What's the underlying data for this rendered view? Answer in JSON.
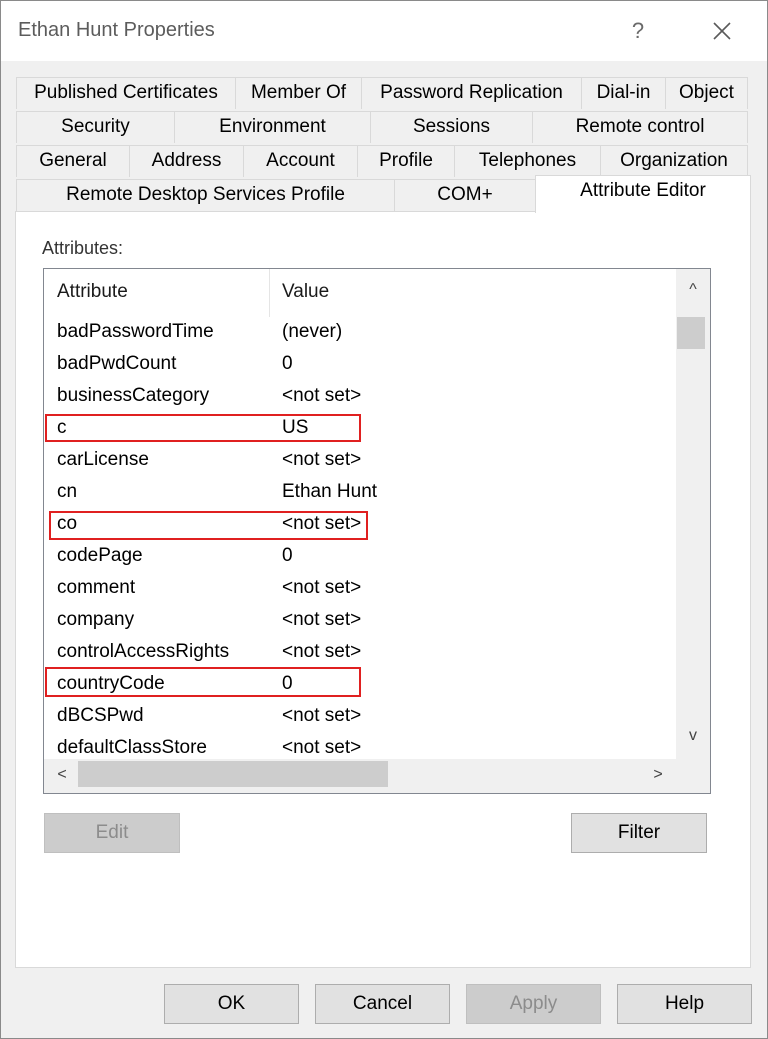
{
  "window": {
    "title": "Ethan Hunt Properties",
    "help_glyph": "?",
    "close_icon": "close-icon"
  },
  "tabs": {
    "row1": [
      "Published Certificates",
      "Member Of",
      "Password Replication",
      "Dial-in",
      "Object"
    ],
    "row2": [
      "Security",
      "Environment",
      "Sessions",
      "Remote control"
    ],
    "row3": [
      "General",
      "Address",
      "Account",
      "Profile",
      "Telephones",
      "Organization"
    ],
    "row4": [
      "Remote Desktop Services Profile",
      "COM+",
      "Attribute Editor"
    ],
    "active": "Attribute Editor"
  },
  "attributes": {
    "label": "Attributes:",
    "columns": [
      "Attribute",
      "Value"
    ],
    "rows": [
      {
        "attribute": "badPasswordTime",
        "value": "(never)"
      },
      {
        "attribute": "badPwdCount",
        "value": "0"
      },
      {
        "attribute": "businessCategory",
        "value": "<not set>"
      },
      {
        "attribute": "c",
        "value": "US"
      },
      {
        "attribute": "carLicense",
        "value": "<not set>"
      },
      {
        "attribute": "cn",
        "value": "Ethan Hunt"
      },
      {
        "attribute": "co",
        "value": "<not set>"
      },
      {
        "attribute": "codePage",
        "value": "0"
      },
      {
        "attribute": "comment",
        "value": "<not set>"
      },
      {
        "attribute": "company",
        "value": "<not set>"
      },
      {
        "attribute": "controlAccessRights",
        "value": "<not set>"
      },
      {
        "attribute": "countryCode",
        "value": "0"
      },
      {
        "attribute": "dBCSPwd",
        "value": "<not set>"
      },
      {
        "attribute": "defaultClassStore",
        "value": "<not set>"
      }
    ],
    "highlighted": [
      "c",
      "co",
      "countryCode"
    ],
    "highlight_color": "#e02020"
  },
  "buttons": {
    "edit": "Edit",
    "filter": "Filter",
    "ok": "OK",
    "cancel": "Cancel",
    "apply": "Apply",
    "help": "Help"
  },
  "scroll": {
    "up": "^",
    "down": "v",
    "left": "<",
    "right": ">"
  }
}
